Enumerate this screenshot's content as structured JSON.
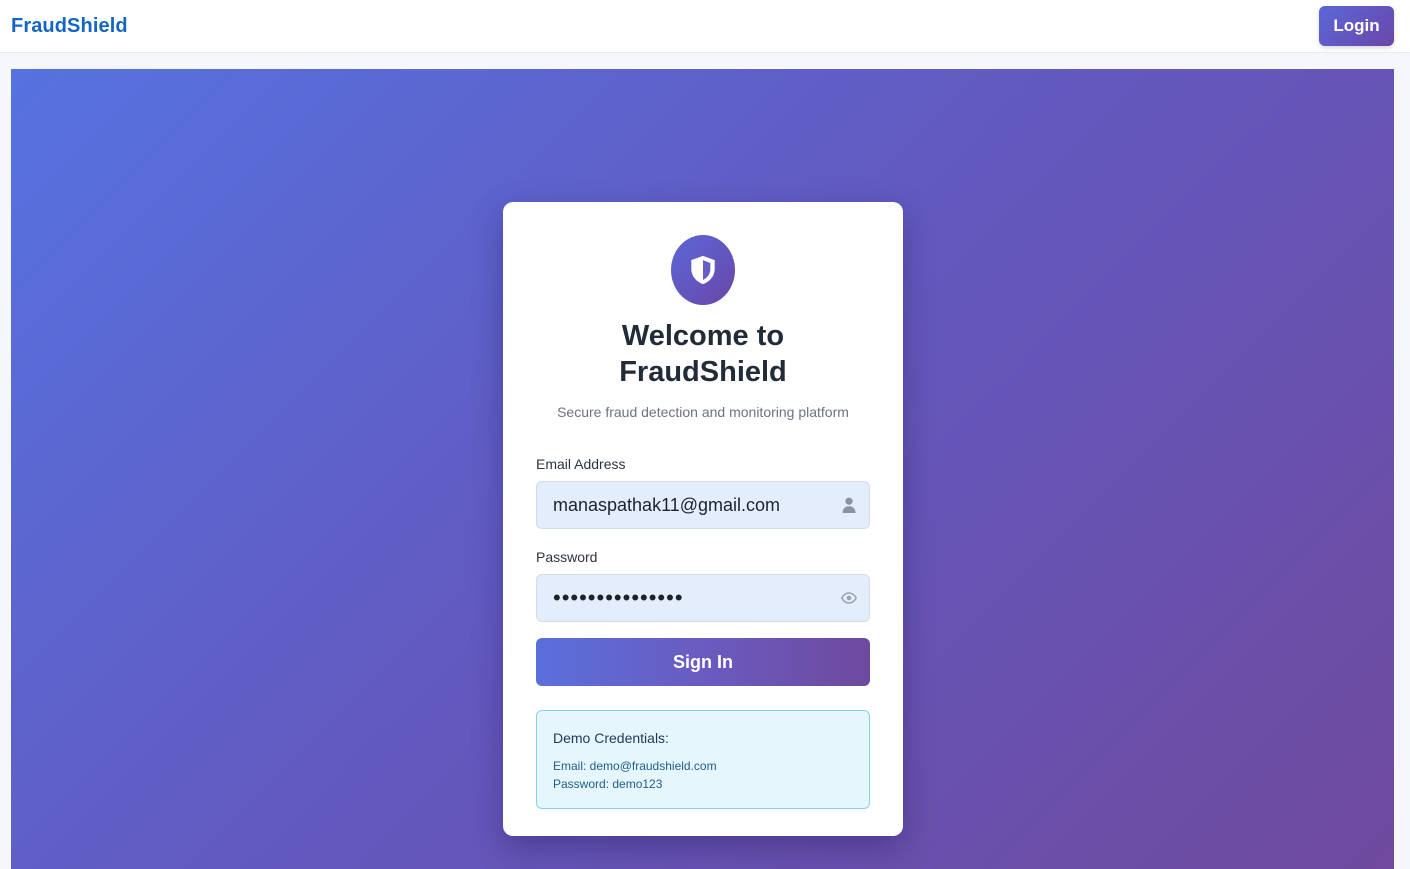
{
  "navbar": {
    "brand": "FraudShield",
    "login_label": "Login"
  },
  "login_card": {
    "icon": "shield-icon",
    "title_line1": "Welcome to",
    "title_line2": "FraudShield",
    "subtitle": "Secure fraud detection and monitoring platform",
    "email": {
      "label": "Email Address",
      "value": "manaspathak11@gmail.com",
      "icon": "user-icon"
    },
    "password": {
      "label": "Password",
      "value": "•••••••••••••••",
      "icon": "eye-icon"
    },
    "signin_label": "Sign In",
    "demo": {
      "title": "Demo Credentials:",
      "email_line": "Email: demo@fraudshield.com",
      "password_line": "Password: demo123"
    }
  },
  "colors": {
    "brand": "#1566c0",
    "gradient_start": "#5a67d8",
    "gradient_end": "#6b46a8",
    "input_bg": "#e3edfb",
    "demo_bg": "#e5f6fc",
    "demo_border": "#86d2e8"
  }
}
